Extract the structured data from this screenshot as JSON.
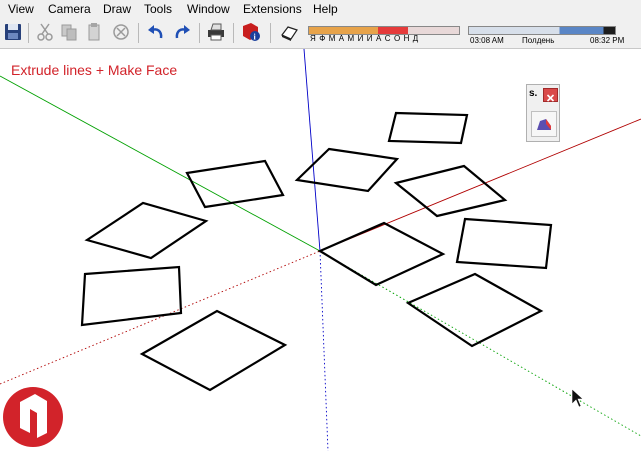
{
  "menu": {
    "items": [
      "View",
      "Camera",
      "Draw",
      "Tools",
      "Window",
      "Extensions",
      "Help"
    ]
  },
  "shadow_settings": {
    "months": "Я Ф М А М И И А С О Н Д",
    "time_start": "03:08 AM",
    "time_noon": "Полдень",
    "time_end": "08:32 PM"
  },
  "overlay": {
    "title": "Extrude lines + Make Face"
  },
  "mini_toolbar": {
    "title": "s."
  },
  "colors": {
    "accent_red": "#d2232a",
    "axis_red": "#b00000",
    "axis_green": "#00a000",
    "axis_blue": "#0000c8"
  }
}
